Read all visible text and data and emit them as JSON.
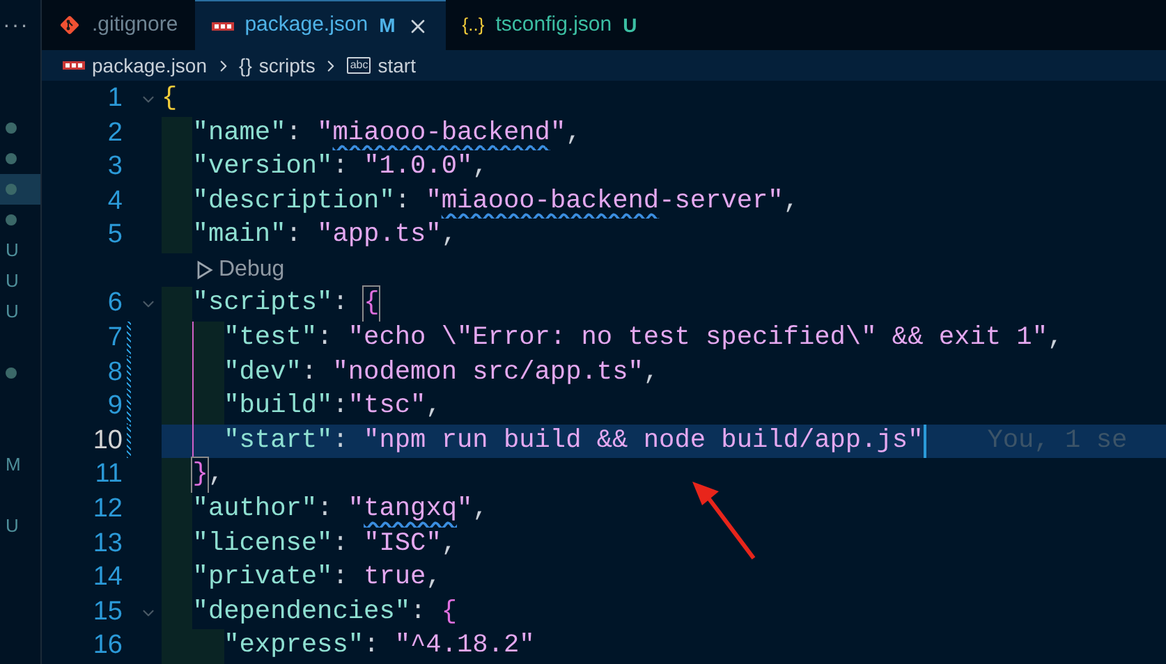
{
  "explorer_strip": {
    "more": "···",
    "markers": [
      {
        "kind": "dot",
        "selected": false
      },
      {
        "kind": "dot",
        "selected": false
      },
      {
        "kind": "dot",
        "selected": true
      },
      {
        "kind": "dot",
        "selected": false
      },
      {
        "kind": "letter",
        "text": "U",
        "selected": false
      },
      {
        "kind": "letter",
        "text": "U",
        "selected": false
      },
      {
        "kind": "letter",
        "text": "U",
        "selected": false
      },
      {
        "kind": "blank",
        "selected": false
      },
      {
        "kind": "dot",
        "selected": false
      },
      {
        "kind": "blank",
        "selected": false
      },
      {
        "kind": "blank",
        "selected": false
      },
      {
        "kind": "letter",
        "text": "M",
        "selected": false
      },
      {
        "kind": "blank",
        "selected": false
      },
      {
        "kind": "letter",
        "text": "U",
        "selected": false
      }
    ]
  },
  "tabs": [
    {
      "label": ".gitignore",
      "kind": "git",
      "selected": false
    },
    {
      "label": "package.json",
      "kind": "npm",
      "status": "M",
      "selected": true
    },
    {
      "label": "tsconfig.json",
      "kind": "json",
      "icon_text": "{..}",
      "status": "U",
      "selected": false
    }
  ],
  "breadcrumb": [
    {
      "label": "package.json",
      "kind": "npm"
    },
    {
      "label": "scripts",
      "kind": "object",
      "icon_text": "{}"
    },
    {
      "label": "start",
      "kind": "string",
      "icon_text": "abc"
    }
  ],
  "lines": [
    {
      "kind": "code",
      "number": "1",
      "fold": true,
      "tokens": [
        {
          "t": "{",
          "kind": "brace1"
        }
      ]
    },
    {
      "kind": "code",
      "number": "2",
      "tokens": [
        {
          "t": "  \"name\"",
          "kind": "key"
        },
        {
          "t": ": ",
          "kind": "punct"
        },
        {
          "t": "\"",
          "kind": "string"
        },
        {
          "t": "miaooo-backend",
          "kind": "string",
          "squiggle": true
        },
        {
          "t": "\"",
          "kind": "string"
        },
        {
          "t": ",",
          "kind": "punct"
        }
      ]
    },
    {
      "kind": "code",
      "number": "3",
      "tokens": [
        {
          "t": "  \"version\"",
          "kind": "key"
        },
        {
          "t": ": ",
          "kind": "punct"
        },
        {
          "t": "\"1.0.0\"",
          "kind": "string"
        },
        {
          "t": ",",
          "kind": "punct"
        }
      ]
    },
    {
      "kind": "code",
      "number": "4",
      "tokens": [
        {
          "t": "  \"description\"",
          "kind": "key"
        },
        {
          "t": ": ",
          "kind": "punct"
        },
        {
          "t": "\"",
          "kind": "string"
        },
        {
          "t": "miaooo-backend",
          "kind": "string",
          "squiggle": true
        },
        {
          "t": "-server\"",
          "kind": "string"
        },
        {
          "t": ",",
          "kind": "punct"
        }
      ]
    },
    {
      "kind": "code",
      "number": "5",
      "tokens": [
        {
          "t": "  \"main\"",
          "kind": "key"
        },
        {
          "t": ": ",
          "kind": "punct"
        },
        {
          "t": "\"app.ts\"",
          "kind": "string"
        },
        {
          "t": ",",
          "kind": "punct"
        }
      ]
    },
    {
      "kind": "codelens",
      "text": "Debug"
    },
    {
      "kind": "code",
      "number": "6",
      "fold": true,
      "tokens": [
        {
          "t": "  \"scripts\"",
          "kind": "key"
        },
        {
          "t": ": ",
          "kind": "punct"
        },
        {
          "t": "{",
          "kind": "brace-match"
        }
      ]
    },
    {
      "kind": "code",
      "number": "7",
      "modified": true,
      "bracket_guide": true,
      "tokens": [
        {
          "t": "    \"test\"",
          "kind": "key"
        },
        {
          "t": ": ",
          "kind": "punct"
        },
        {
          "t": "\"echo \\\"Error: no test specified\\\" && exit 1\"",
          "kind": "string"
        },
        {
          "t": ",",
          "kind": "punct"
        }
      ]
    },
    {
      "kind": "code",
      "number": "8",
      "modified": true,
      "bracket_guide": true,
      "tokens": [
        {
          "t": "    \"dev\"",
          "kind": "key"
        },
        {
          "t": ": ",
          "kind": "punct"
        },
        {
          "t": "\"nodemon src/app.ts\"",
          "kind": "string"
        },
        {
          "t": ",",
          "kind": "punct"
        }
      ]
    },
    {
      "kind": "code",
      "number": "9",
      "modified": true,
      "bracket_guide": true,
      "tokens": [
        {
          "t": "    \"build\"",
          "kind": "key"
        },
        {
          "t": ":",
          "kind": "punct"
        },
        {
          "t": "\"tsc\"",
          "kind": "string"
        },
        {
          "t": ",",
          "kind": "punct"
        }
      ]
    },
    {
      "kind": "code",
      "number": "10",
      "modified": true,
      "bracket_guide": true,
      "current": true,
      "blame": "You, 1 se",
      "tokens": [
        {
          "t": "    \"start\"",
          "kind": "key"
        },
        {
          "t": ": ",
          "kind": "punct"
        },
        {
          "t": "\"npm run build && node build/app.js\"",
          "kind": "string"
        }
      ]
    },
    {
      "kind": "code",
      "number": "11",
      "tokens": [
        {
          "t": "  }",
          "kind": "brace-match"
        },
        {
          "t": ",",
          "kind": "punct"
        }
      ]
    },
    {
      "kind": "code",
      "number": "12",
      "tokens": [
        {
          "t": "  \"author\"",
          "kind": "key"
        },
        {
          "t": ": ",
          "kind": "punct"
        },
        {
          "t": "\"",
          "kind": "string"
        },
        {
          "t": "tangxq",
          "kind": "string",
          "squiggle": true
        },
        {
          "t": "\"",
          "kind": "string"
        },
        {
          "t": ",",
          "kind": "punct"
        }
      ]
    },
    {
      "kind": "code",
      "number": "13",
      "tokens": [
        {
          "t": "  \"license\"",
          "kind": "key"
        },
        {
          "t": ": ",
          "kind": "punct"
        },
        {
          "t": "\"ISC\"",
          "kind": "string"
        },
        {
          "t": ",",
          "kind": "punct"
        }
      ]
    },
    {
      "kind": "code",
      "number": "14",
      "tokens": [
        {
          "t": "  \"private\"",
          "kind": "key"
        },
        {
          "t": ": ",
          "kind": "punct"
        },
        {
          "t": "true",
          "kind": "bool"
        },
        {
          "t": ",",
          "kind": "punct"
        }
      ]
    },
    {
      "kind": "code",
      "number": "15",
      "fold": true,
      "tokens": [
        {
          "t": "  \"dependencies\"",
          "kind": "key"
        },
        {
          "t": ": ",
          "kind": "punct"
        },
        {
          "t": "{",
          "kind": "brace2"
        }
      ]
    },
    {
      "kind": "code",
      "number": "16",
      "tokens": [
        {
          "t": "    \"express\"",
          "kind": "key"
        },
        {
          "t": ": ",
          "kind": "punct"
        },
        {
          "t": "\"^4.18.2\"",
          "kind": "string"
        }
      ]
    }
  ]
}
